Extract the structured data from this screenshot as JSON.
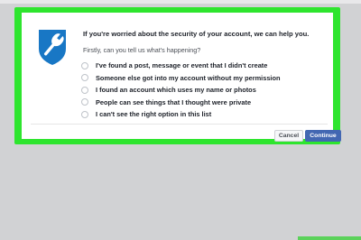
{
  "colors": {
    "frame_highlight": "#2ee52e",
    "shield": "#1877c5",
    "continue_button": "#4267b2",
    "background": "#d1d2d4"
  },
  "dialog": {
    "icon": "shield-wrench-icon",
    "heading": "If you're worried about the security of your account, we can help you.",
    "subheading": "Firstly, can you tell us what's happening?",
    "options": [
      "I've found a post, message or event that I didn't create",
      "Someone else got into my account without my permission",
      "I found an account which uses my name or photos",
      "People can see things that I thought were private",
      "I can't see the right option in this list"
    ],
    "cancel_label": "Cancel",
    "continue_label": "Continue"
  }
}
